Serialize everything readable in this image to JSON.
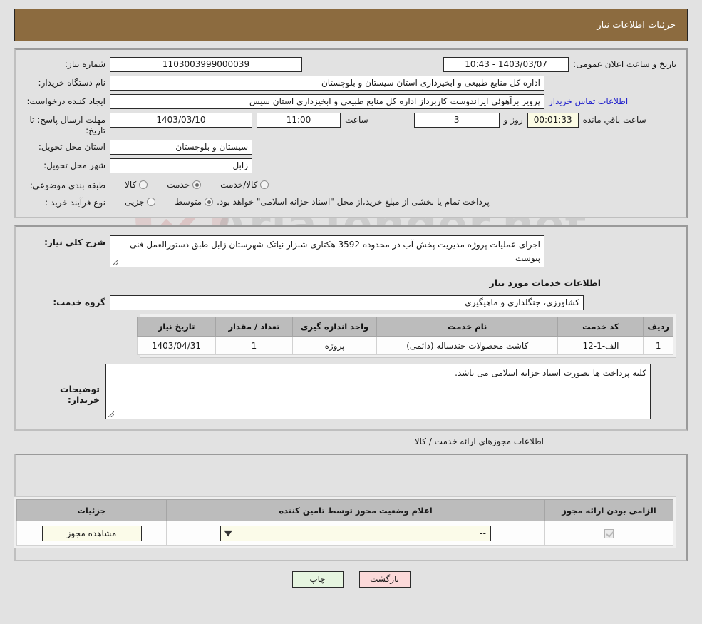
{
  "header": {
    "title": "جزئیات اطلاعات نیاز"
  },
  "fields": {
    "need_number_label": "شماره نیاز:",
    "need_number_value": "1103003999000039",
    "publish_label": "تاریخ و ساعت اعلان عمومی:",
    "publish_value": "1403/03/07 - 10:43",
    "buyer_org_label": "نام دستگاه خریدار:",
    "buyer_org_value": "اداره کل منابع طبیعی و ابخیزداری استان سیستان و بلوچستان",
    "creator_label": "ایجاد کننده درخواست:",
    "creator_value": "پرویز برآهوئی ایراندوست کاربرداز اداره کل منابع طبیعی و ابخیزداری استان سیس",
    "creator_contact_link": "اطلاعات تماس خریدار",
    "deadline_label": "مهلت ارسال پاسخ: تا تاریخ:",
    "deadline_date": "1403/03/10",
    "deadline_time_label": "ساعت",
    "deadline_time": "11:00",
    "days_remaining": "3",
    "days_label": "روز و",
    "timer": "00:01:33",
    "timer_label": "ساعت باقي مانده",
    "province_label": "استان محل تحویل:",
    "province_value": "سیستان و بلوچستان",
    "city_label": "شهر محل تحویل:",
    "city_value": "زابل",
    "category_label": "طبقه بندی موضوعی:",
    "process_label": "نوع فرآیند خرید :",
    "process_note": "پرداخت تمام یا بخشی از مبلغ خرید،از محل \"اسناد خزانه اسلامی\" خواهد بود."
  },
  "category_options": [
    {
      "label": "کالا",
      "selected": false
    },
    {
      "label": "خدمت",
      "selected": true
    },
    {
      "label": "کالا/خدمت",
      "selected": false
    }
  ],
  "process_options": [
    {
      "label": "جزیی",
      "selected": false
    },
    {
      "label": "متوسط",
      "selected": true
    }
  ],
  "description": {
    "label": "شرح کلی نیاز:",
    "value": "اجرای عملیات پروژه مدیریت پخش آب در محدوده 3592 هکتاری شنزار نیاتک شهرستان زابل طبق دستورالعمل فنی پیوست"
  },
  "services": {
    "section_title": "اطلاعات خدمات مورد نیاز",
    "group_label": "گروه خدمت:",
    "group_value": "کشاورزی، جنگلداری و ماهیگیری",
    "columns": [
      "ردیف",
      "کد خدمت",
      "نام خدمت",
      "واحد اندازه گیری",
      "تعداد / مقدار",
      "تاریخ نیاز"
    ],
    "rows": [
      {
        "row": "1",
        "code": "الف-1-12",
        "name": "کاشت محصولات چندساله (دائمی)",
        "unit": "پروژه",
        "quantity": "1",
        "need_date": "1403/04/31"
      }
    ]
  },
  "buyer_notes": {
    "label": "توضیحات خریدار:",
    "value": "کلیه پرداخت ها بصورت اسناد خزانه اسلامی می باشد."
  },
  "permits": {
    "caption": "اطلاعات مجوزهای ارائه خدمت / کالا",
    "columns": [
      "الزامی بودن ارائه مجوز",
      "اعلام وضعیت مجوز توسط تامین کننده",
      "جزئیات"
    ],
    "rows": [
      {
        "required": true,
        "status_value": "--",
        "details_button": "مشاهده مجوز"
      }
    ]
  },
  "footer": {
    "back_label": "بازگشت",
    "print_label": "چاپ"
  },
  "watermark": {
    "text": "AriaTender.net"
  },
  "colors": {
    "header_brown": "#8c6b3f",
    "page_bg": "#e2e2e2",
    "link_blue": "#2222cc",
    "back_button": "#fbd9d9",
    "print_button": "#e6f5e0",
    "field_yellow": "#fbfbe9"
  }
}
